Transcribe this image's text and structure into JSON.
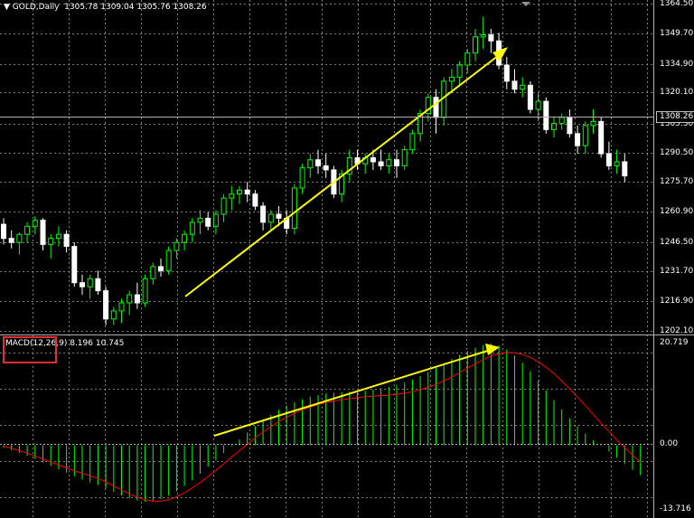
{
  "header": {
    "symbol_arrow": "▼",
    "title": "GOLD,Daily",
    "ohlc": "1305.78 1309.04 1305.76 1308.26"
  },
  "price_axis": {
    "labels": [
      "1364.50",
      "1349.70",
      "1334.90",
      "1320.10",
      "1305.30",
      "1290.50",
      "1275.70",
      "1260.90",
      "1246.50",
      "1231.70",
      "1216.90",
      "1202.10"
    ],
    "current_price": "1308.26"
  },
  "macd": {
    "label": "MACD(12,26,9) 8.196 10.745",
    "axis_top": "20.719",
    "axis_zero": "0.00",
    "axis_bottom": "-13.716"
  },
  "colors": {
    "background": "#000000",
    "grid": "#b0b0b0",
    "candle_up": "#00ff00",
    "candle_down": "#ffffff",
    "histogram": "#00ff00",
    "signal": "#ff0000",
    "annotation_arrow": "#ffff00",
    "highlight_box": "#e03030"
  },
  "chart_data": [
    {
      "type": "candlestick",
      "title": "GOLD,Daily",
      "ylim": [
        1202.1,
        1364.5
      ],
      "bars": [
        [
          1255,
          1258,
          1245,
          1248
        ],
        [
          1248,
          1252,
          1243,
          1246
        ],
        [
          1246,
          1251,
          1240,
          1250
        ],
        [
          1250,
          1256,
          1246,
          1254
        ],
        [
          1254,
          1259,
          1250,
          1257
        ],
        [
          1257,
          1258,
          1242,
          1245
        ],
        [
          1245,
          1250,
          1238,
          1248
        ],
        [
          1248,
          1254,
          1244,
          1250
        ],
        [
          1250,
          1252,
          1241,
          1244
        ],
        [
          1244,
          1246,
          1224,
          1226
        ],
        [
          1226,
          1230,
          1220,
          1224
        ],
        [
          1224,
          1230,
          1218,
          1228
        ],
        [
          1228,
          1232,
          1220,
          1222
        ],
        [
          1222,
          1224,
          1205,
          1208
        ],
        [
          1208,
          1214,
          1205,
          1212
        ],
        [
          1212,
          1218,
          1206,
          1216
        ],
        [
          1216,
          1222,
          1210,
          1220
        ],
        [
          1220,
          1226,
          1213,
          1216
        ],
        [
          1216,
          1230,
          1214,
          1228
        ],
        [
          1228,
          1236,
          1225,
          1234
        ],
        [
          1234,
          1238,
          1229,
          1232
        ],
        [
          1232,
          1244,
          1230,
          1242
        ],
        [
          1242,
          1248,
          1238,
          1246
        ],
        [
          1246,
          1252,
          1242,
          1250
        ],
        [
          1250,
          1258,
          1246,
          1256
        ],
        [
          1256,
          1262,
          1250,
          1258
        ],
        [
          1258,
          1261,
          1252,
          1254
        ],
        [
          1254,
          1262,
          1250,
          1260
        ],
        [
          1260,
          1270,
          1256,
          1268
        ],
        [
          1268,
          1274,
          1262,
          1270
        ],
        [
          1270,
          1274,
          1265,
          1272
        ],
        [
          1272,
          1276,
          1266,
          1270
        ],
        [
          1270,
          1272,
          1262,
          1264
        ],
        [
          1264,
          1266,
          1252,
          1256
        ],
        [
          1256,
          1262,
          1252,
          1260
        ],
        [
          1260,
          1264,
          1254,
          1258
        ],
        [
          1258,
          1262,
          1250,
          1253
        ],
        [
          1253,
          1275,
          1250,
          1273
        ],
        [
          1273,
          1285,
          1270,
          1283
        ],
        [
          1283,
          1290,
          1278,
          1287
        ],
        [
          1287,
          1292,
          1280,
          1284
        ],
        [
          1284,
          1290,
          1278,
          1282
        ],
        [
          1282,
          1284,
          1268,
          1270
        ],
        [
          1270,
          1282,
          1266,
          1280
        ],
        [
          1280,
          1292,
          1276,
          1288
        ],
        [
          1288,
          1292,
          1282,
          1285
        ],
        [
          1285,
          1290,
          1280,
          1288
        ],
        [
          1288,
          1292,
          1282,
          1286
        ],
        [
          1286,
          1292,
          1282,
          1284
        ],
        [
          1284,
          1290,
          1280,
          1287
        ],
        [
          1287,
          1292,
          1278,
          1284
        ],
        [
          1284,
          1294,
          1282,
          1292
        ],
        [
          1292,
          1302,
          1290,
          1300
        ],
        [
          1300,
          1312,
          1296,
          1310
        ],
        [
          1310,
          1320,
          1306,
          1318
        ],
        [
          1318,
          1322,
          1300,
          1308
        ],
        [
          1308,
          1328,
          1304,
          1326
        ],
        [
          1326,
          1332,
          1320,
          1328
        ],
        [
          1328,
          1336,
          1324,
          1334
        ],
        [
          1334,
          1342,
          1330,
          1340
        ],
        [
          1340,
          1352,
          1336,
          1348
        ],
        [
          1348,
          1358,
          1342,
          1349
        ],
        [
          1349,
          1352,
          1340,
          1346
        ],
        [
          1346,
          1350,
          1332,
          1334
        ],
        [
          1334,
          1338,
          1322,
          1326
        ],
        [
          1326,
          1332,
          1320,
          1322
        ],
        [
          1322,
          1328,
          1318,
          1324
        ],
        [
          1324,
          1326,
          1310,
          1312
        ],
        [
          1312,
          1320,
          1306,
          1316
        ],
        [
          1316,
          1318,
          1300,
          1302
        ],
        [
          1302,
          1308,
          1298,
          1305
        ],
        [
          1305,
          1310,
          1302,
          1308
        ],
        [
          1308,
          1312,
          1298,
          1300
        ],
        [
          1300,
          1304,
          1290,
          1294
        ],
        [
          1294,
          1306,
          1290,
          1304
        ],
        [
          1304,
          1312,
          1300,
          1306
        ],
        [
          1306,
          1308,
          1288,
          1290
        ],
        [
          1290,
          1296,
          1282,
          1284
        ],
        [
          1284,
          1292,
          1280,
          1286
        ],
        [
          1286,
          1290,
          1276,
          1279
        ]
      ]
    },
    {
      "type": "bar",
      "title": "MACD(12,26,9) 8.196 10.745",
      "ylim": [
        -13.716,
        20.719
      ],
      "histogram": [
        -0.5,
        -1.0,
        -1.6,
        -2.2,
        -2.8,
        -3.5,
        -4.2,
        -4.9,
        -5.6,
        -6.3,
        -7.0,
        -7.6,
        -8.1,
        -8.8,
        -9.5,
        -10.2,
        -10.8,
        -11.3,
        -11.5,
        -11.4,
        -11.0,
        -10.3,
        -9.4,
        -8.3,
        -7.1,
        -5.8,
        -4.4,
        -3.0,
        -1.6,
        -0.2,
        1.2,
        2.6,
        3.9,
        5.1,
        6.2,
        7.2,
        8.1,
        8.8,
        9.4,
        9.9,
        10.2,
        10.5,
        10.7,
        10.8,
        10.9,
        11.0,
        11.1,
        11.3,
        11.6,
        11.9,
        12.3,
        12.8,
        13.4,
        14.1,
        14.9,
        15.8,
        16.7,
        17.6,
        18.4,
        19.2,
        19.9,
        20.4,
        20.7,
        20.3,
        19.5,
        18.3,
        16.8,
        15.1,
        13.2,
        11.2,
        9.2,
        7.3,
        5.5,
        3.9,
        2.4,
        1.0,
        -0.2,
        -1.3,
        -2.5,
        -3.8,
        -5.0,
        -6.1
      ],
      "signal": [
        -0.2,
        -0.6,
        -1.1,
        -1.6,
        -2.2,
        -2.8,
        -3.4,
        -4.0,
        -4.6,
        -5.2,
        -5.7,
        -6.2,
        -6.8,
        -7.5,
        -8.3,
        -9.1,
        -9.9,
        -10.6,
        -11.1,
        -11.4,
        -11.4,
        -11.1,
        -10.5,
        -9.7,
        -8.7,
        -7.6,
        -6.4,
        -5.1,
        -3.8,
        -2.4,
        -1.1,
        0.2,
        1.5,
        2.7,
        3.8,
        4.8,
        5.7,
        6.5,
        7.2,
        7.8,
        8.3,
        8.7,
        9.0,
        9.3,
        9.5,
        9.7,
        9.9,
        10.0,
        10.1,
        10.2,
        10.4,
        10.6,
        10.9,
        11.3,
        11.8,
        12.4,
        13.1,
        13.9,
        14.8,
        15.7,
        16.6,
        17.4,
        18.2,
        18.6,
        18.9,
        18.8,
        18.5,
        17.9,
        17.0,
        15.9,
        14.6,
        13.1,
        11.5,
        9.8,
        8.1,
        6.3,
        4.5,
        2.8,
        1.1,
        -0.5,
        -2.0,
        -3.4
      ]
    }
  ]
}
